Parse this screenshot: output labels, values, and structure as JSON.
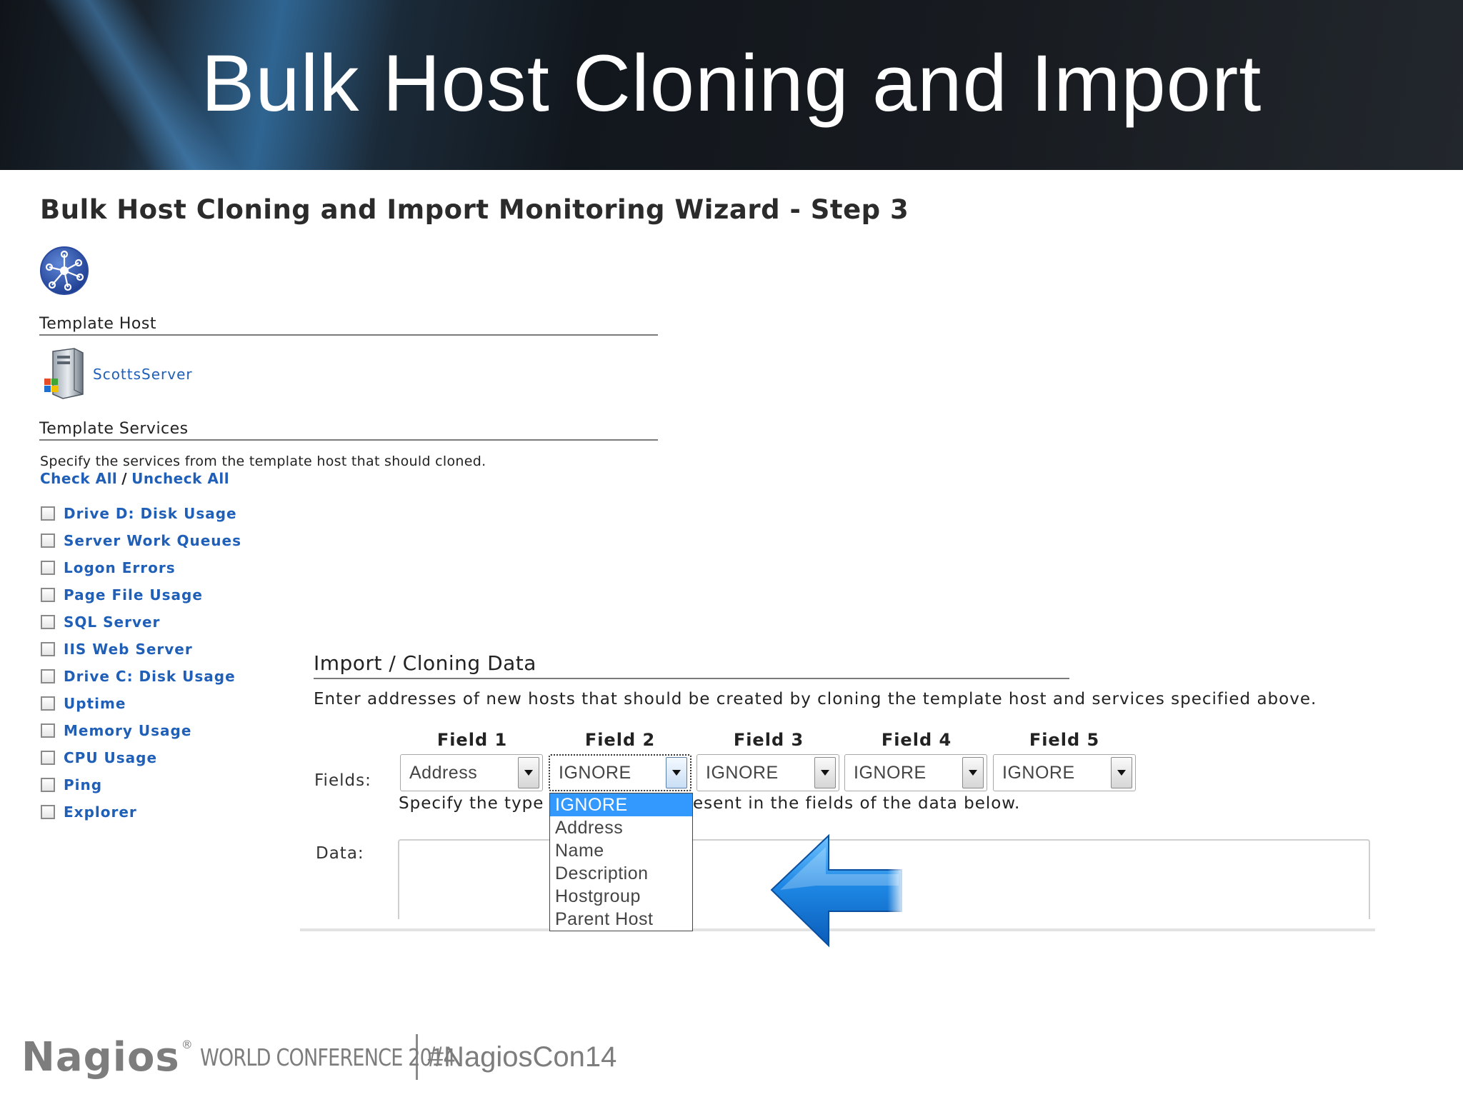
{
  "slide": {
    "title": "Bulk Host Cloning and Import"
  },
  "wizard": {
    "title": "Bulk Host Cloning and Import Monitoring Wizard - Step 3",
    "icon": "network-hub-icon"
  },
  "template_host": {
    "heading": "Template Host",
    "icon": "windows-server-icon",
    "host_name": "ScottsServer"
  },
  "template_services": {
    "heading": "Template Services",
    "description": "Specify the services from the template host that should cloned.",
    "check_all": "Check All",
    "separator": "/",
    "uncheck_all": "Uncheck All",
    "services": [
      {
        "label": "Drive D: Disk Usage",
        "checked": false
      },
      {
        "label": "Server Work Queues",
        "checked": false
      },
      {
        "label": "Logon Errors",
        "checked": false
      },
      {
        "label": "Page File Usage",
        "checked": false
      },
      {
        "label": "SQL Server",
        "checked": false
      },
      {
        "label": "IIS Web Server",
        "checked": false
      },
      {
        "label": "Drive C: Disk Usage",
        "checked": false
      },
      {
        "label": "Uptime",
        "checked": false
      },
      {
        "label": "Memory Usage",
        "checked": false
      },
      {
        "label": "CPU Usage",
        "checked": false
      },
      {
        "label": "Ping",
        "checked": false
      },
      {
        "label": "Explorer",
        "checked": false
      }
    ]
  },
  "import": {
    "heading": "Import / Cloning Data",
    "description": "Enter addresses of new hosts that should be created by cloning the template host and services specified above.",
    "fields_label": "Fields:",
    "data_label": "Data:",
    "type_hint_left": "Specify the type",
    "type_hint_right": "esent in the fields of the data below.",
    "field_headers": [
      "Field 1",
      "Field 2",
      "Field 3",
      "Field 4",
      "Field 5"
    ],
    "field_values": [
      "Address",
      "IGNORE",
      "IGNORE",
      "IGNORE",
      "IGNORE"
    ],
    "data_value": "",
    "dropdown_open_field": "Field 2",
    "dropdown_options": [
      "IGNORE",
      "Address",
      "Name",
      "Description",
      "Hostgroup",
      "Parent Host"
    ],
    "dropdown_highlighted": "IGNORE"
  },
  "annotation": {
    "arrow_icon": "blue-left-arrow-icon",
    "arrow_color": "#1e88e5"
  },
  "footer": {
    "logo_text": "Nagios",
    "registered": "®",
    "conference": "WORLD CONFERENCE 2014",
    "hashtag": "#NagiosCon14"
  },
  "colors": {
    "link": "#1f5fb8",
    "dropdown_highlight": "#3399ff",
    "banner_dark": "#12171d"
  }
}
